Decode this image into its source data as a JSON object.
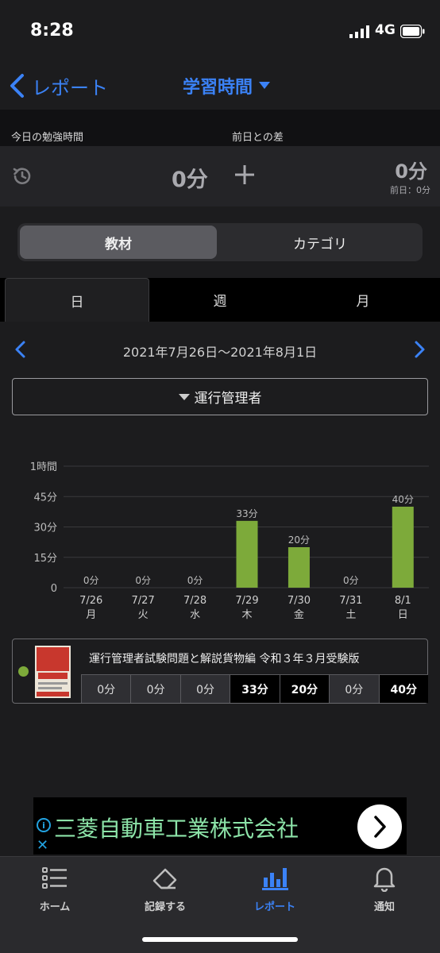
{
  "status": {
    "time": "8:28",
    "network": "4G"
  },
  "nav": {
    "back_label": "レポート",
    "title": "学習時間"
  },
  "today": {
    "study_label": "今日の勉強時間",
    "diff_label": "前日との差",
    "study_value": "0分",
    "diff_value": "0分",
    "prev_day": "前日：0分"
  },
  "segment": {
    "options": [
      "教材",
      "カテゴリ"
    ],
    "selected": "教材"
  },
  "period_tabs": {
    "items": [
      "日",
      "週",
      "月"
    ],
    "selected": "日"
  },
  "range": {
    "label": "2021年7月26日〜2021年8月1日"
  },
  "filter": {
    "selected": "運行管理者"
  },
  "chart_data": {
    "type": "bar",
    "categories": [
      "7/26",
      "7/27",
      "7/28",
      "7/29",
      "7/30",
      "7/31",
      "8/1"
    ],
    "weekdays": [
      "月",
      "火",
      "水",
      "木",
      "金",
      "土",
      "日"
    ],
    "values": [
      0,
      0,
      0,
      33,
      20,
      0,
      40
    ],
    "value_labels": [
      "0分",
      "0分",
      "0分",
      "33分",
      "20分",
      "0分",
      "40分"
    ],
    "y_ticks": [
      0,
      15,
      30,
      45,
      60
    ],
    "y_tick_labels": [
      "0",
      "15分",
      "30分",
      "45分",
      "1時間"
    ],
    "ylim": [
      0,
      60
    ],
    "unit": "分",
    "bar_color": "#7daa3a",
    "grid": true,
    "title": "",
    "xlabel": "",
    "ylabel": ""
  },
  "material": {
    "name": "運行管理者試験問題と解説貨物編 令和３年３月受験版",
    "values": [
      "0分",
      "0分",
      "0分",
      "33分",
      "20分",
      "0分",
      "40分"
    ],
    "color": "#7daa3a"
  },
  "ad": {
    "text": "三菱自動車工業株式会社"
  },
  "tabbar": {
    "items": [
      {
        "label": "ホーム",
        "icon": "list-icon"
      },
      {
        "label": "記録する",
        "icon": "eraser-icon"
      },
      {
        "label": "レポート",
        "icon": "bar-chart-icon"
      },
      {
        "label": "通知",
        "icon": "bell-icon"
      }
    ],
    "selected": "レポート"
  },
  "colors": {
    "accent": "#3b82f6",
    "background": "#1c1c1e"
  }
}
